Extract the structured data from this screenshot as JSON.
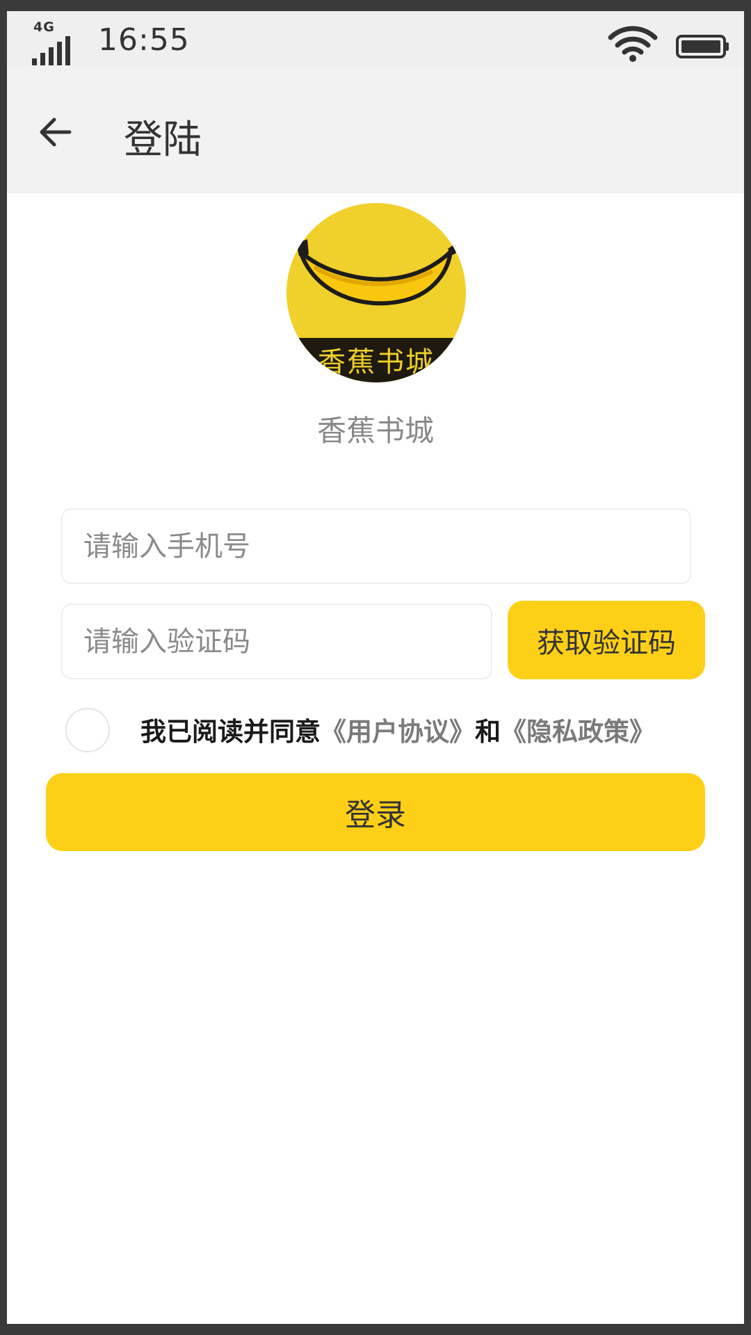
{
  "status_bar": {
    "network": "4G",
    "time": "16:55"
  },
  "header": {
    "title": "登陆"
  },
  "logo": {
    "caption": "香蕉书城"
  },
  "app_name": "香蕉书城",
  "form": {
    "phone_placeholder": "请输入手机号",
    "code_placeholder": "请输入验证码",
    "get_code_label": "获取验证码",
    "agreement_prefix": "我已阅读并同意",
    "user_agreement_link": "《用户协议》",
    "agreement_conjunction": "和",
    "privacy_link": "《隐私政策》",
    "login_label": "登录"
  },
  "colors": {
    "accent": "#fdd017",
    "logo_yellow": "#f0d02a",
    "header_bg": "#f2f2f2"
  },
  "icons": [
    "signal-icon",
    "wifi-icon",
    "battery-icon",
    "back-arrow-icon",
    "banana-icon"
  ]
}
